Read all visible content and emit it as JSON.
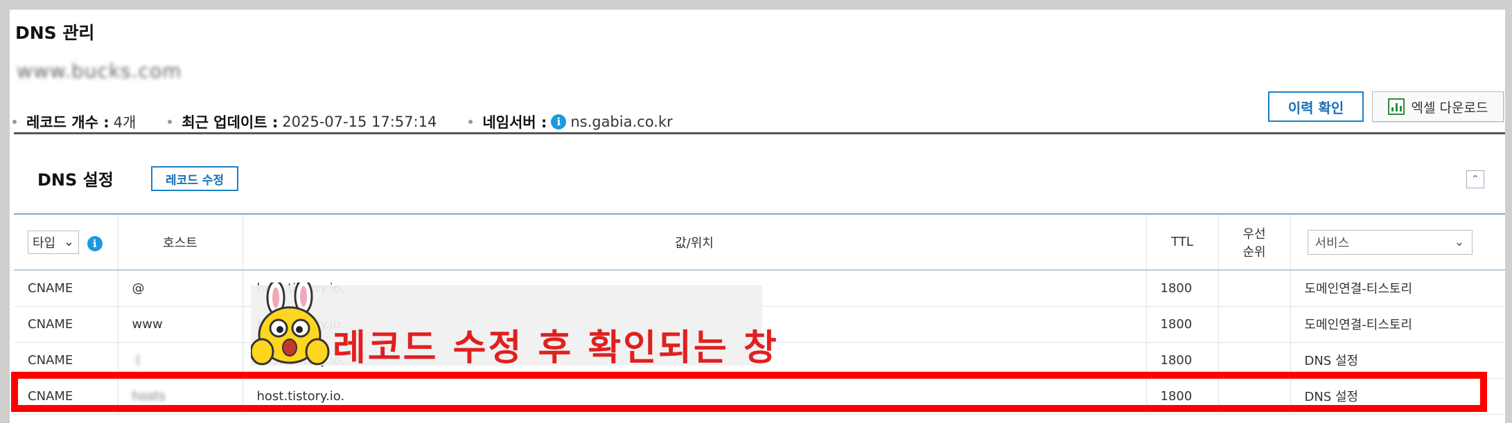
{
  "page": {
    "title": "DNS 관리",
    "domain_masked": "www.bucks.com"
  },
  "summary": {
    "record_count_label": "레코드 개수 :",
    "record_count_value": "4개",
    "last_update_label": "최근 업데이트 :",
    "last_update_value": "2025-07-15 17:57:14",
    "nameserver_label": "네임서버 :",
    "nameserver_value": "ns.gabia.co.kr"
  },
  "buttons": {
    "history": "이력 확인",
    "excel": "엑셀 다운로드"
  },
  "section": {
    "title": "DNS 설정",
    "edit_record": "레코드 수정"
  },
  "table": {
    "type_filter": "타입",
    "headers": {
      "host": "호스트",
      "value": "값/위치",
      "ttl": "TTL",
      "priority_line1": "우선",
      "priority_line2": "순위"
    },
    "service_filter": "서비스",
    "rows": [
      {
        "type": "CNAME",
        "host": "@",
        "value": "host.tistory.io.",
        "ttl": "1800",
        "priority": "",
        "service": "도메인연결-티스토리"
      },
      {
        "type": "CNAME",
        "host": "www",
        "value": "host.tistory.io.",
        "ttl": "1800",
        "priority": "",
        "service": "도메인연결-티스토리"
      },
      {
        "type": "CNAME",
        "host": "ㅣ",
        "value": "host.tistory.io.",
        "ttl": "1800",
        "priority": "",
        "service": "DNS 설정"
      },
      {
        "type": "CNAME",
        "host": "hosts",
        "value": "host.tistory.io.",
        "ttl": "1800",
        "priority": "",
        "service": "DNS 설정"
      }
    ]
  },
  "overlay": {
    "caption": "레코드 수정 후 확인되는 창"
  },
  "colors": {
    "accent": "#1a7fc6",
    "highlight": "#ff0000",
    "caption": "#e02020"
  }
}
